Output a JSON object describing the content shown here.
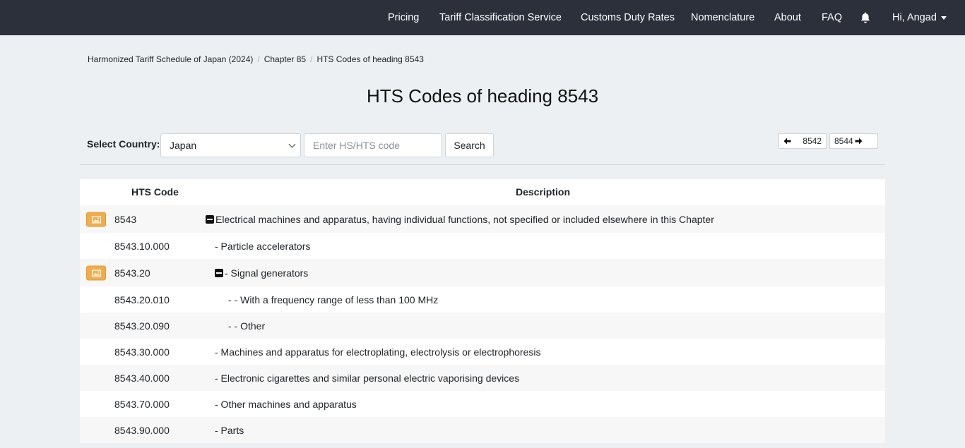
{
  "nav": {
    "items": [
      "Pricing",
      "Tariff Classification Service",
      "Customs Duty Rates",
      "Nomenclature",
      "About",
      "FAQ"
    ],
    "user": "Hi, Angad",
    "bell_icon": "bell-icon"
  },
  "breadcrumb": [
    "Harmonized Tariff Schedule of Japan (2024)",
    "Chapter 85",
    "HTS Codes of heading 8543"
  ],
  "title": "HTS Codes of heading 8543",
  "search": {
    "country_label": "Select Country:",
    "country": "Japan",
    "placeholder": "Enter HS/HTS code",
    "button": "Search"
  },
  "pager": {
    "prev": "8542",
    "next": "8544"
  },
  "table": {
    "headers": {
      "code": "HTS Code",
      "description": "Description"
    },
    "rows": [
      {
        "code": "8543",
        "description": "Electrical machines and apparatus, having individual functions, not specified or included elsewhere in this Chapter",
        "has_image": true,
        "collapsible": true,
        "level": 0
      },
      {
        "code": "8543.10.000",
        "description": "- Particle accelerators",
        "has_image": false,
        "collapsible": false,
        "level": 1
      },
      {
        "code": "8543.20",
        "description": "- Signal generators",
        "has_image": true,
        "collapsible": true,
        "level": 1
      },
      {
        "code": "8543.20.010",
        "description": "- - With a frequency range of less than 100 MHz",
        "has_image": false,
        "collapsible": false,
        "level": 2
      },
      {
        "code": "8543.20.090",
        "description": "- - Other",
        "has_image": false,
        "collapsible": false,
        "level": 2
      },
      {
        "code": "8543.30.000",
        "description": "- Machines and apparatus for electroplating, electrolysis or electrophoresis",
        "has_image": false,
        "collapsible": false,
        "level": 1
      },
      {
        "code": "8543.40.000",
        "description": "- Electronic cigarettes and similar personal electric vaporising devices",
        "has_image": false,
        "collapsible": false,
        "level": 1
      },
      {
        "code": "8543.70.000",
        "description": "- Other machines and apparatus",
        "has_image": false,
        "collapsible": false,
        "level": 1
      },
      {
        "code": "8543.90.000",
        "description": "- Parts",
        "has_image": false,
        "collapsible": false,
        "level": 1
      }
    ]
  },
  "colors": {
    "navbar": "#2c303b",
    "image_button": "#f0ad4e",
    "page_bg": "#ecf0f3"
  }
}
